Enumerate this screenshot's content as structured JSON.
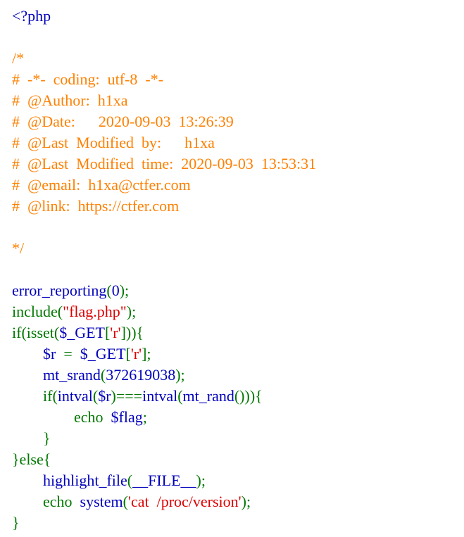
{
  "colors": {
    "html": "#0000BB",
    "comment": "#FF8000",
    "default": "#0000BB",
    "keyword": "#007700",
    "string": "#DD0000"
  },
  "source_lines": [
    [
      {
        "t": "<?php",
        "c": "html"
      }
    ],
    [],
    [
      {
        "t": "/*",
        "c": "comment"
      }
    ],
    [
      {
        "t": "#  -*-  coding:  utf-8  -*-",
        "c": "comment"
      }
    ],
    [
      {
        "t": "#  @Author:  h1xa",
        "c": "comment"
      }
    ],
    [
      {
        "t": "#  @Date:      2020-09-03  13:26:39",
        "c": "comment"
      }
    ],
    [
      {
        "t": "#  @Last  Modified  by:      h1xa",
        "c": "comment"
      }
    ],
    [
      {
        "t": "#  @Last  Modified  time:  2020-09-03  13:53:31",
        "c": "comment"
      }
    ],
    [
      {
        "t": "#  @email:  h1xa@ctfer.com",
        "c": "comment"
      }
    ],
    [
      {
        "t": "#  @link:  https://ctfer.com",
        "c": "comment"
      }
    ],
    [],
    [
      {
        "t": "*/",
        "c": "comment"
      }
    ],
    [],
    [
      {
        "t": "error_reporting",
        "c": "default"
      },
      {
        "t": "(",
        "c": "keyword"
      },
      {
        "t": "0",
        "c": "default"
      },
      {
        "t": ");",
        "c": "keyword"
      }
    ],
    [
      {
        "t": "include(",
        "c": "keyword"
      },
      {
        "t": "\"flag.php\"",
        "c": "string"
      },
      {
        "t": ");",
        "c": "keyword"
      }
    ],
    [
      {
        "t": "if(isset(",
        "c": "keyword"
      },
      {
        "t": "$_GET",
        "c": "default"
      },
      {
        "t": "[",
        "c": "keyword"
      },
      {
        "t": "'r'",
        "c": "string"
      },
      {
        "t": "])){",
        "c": "keyword"
      }
    ],
    [
      {
        "t": "        ",
        "c": "default"
      },
      {
        "t": "$r",
        "c": "default"
      },
      {
        "t": "  =  ",
        "c": "keyword"
      },
      {
        "t": "$_GET",
        "c": "default"
      },
      {
        "t": "[",
        "c": "keyword"
      },
      {
        "t": "'r'",
        "c": "string"
      },
      {
        "t": "];",
        "c": "keyword"
      }
    ],
    [
      {
        "t": "        ",
        "c": "default"
      },
      {
        "t": "mt_srand",
        "c": "default"
      },
      {
        "t": "(",
        "c": "keyword"
      },
      {
        "t": "372619038",
        "c": "default"
      },
      {
        "t": ");",
        "c": "keyword"
      }
    ],
    [
      {
        "t": "        ",
        "c": "default"
      },
      {
        "t": "if(",
        "c": "keyword"
      },
      {
        "t": "intval",
        "c": "default"
      },
      {
        "t": "(",
        "c": "keyword"
      },
      {
        "t": "$r",
        "c": "default"
      },
      {
        "t": ")===",
        "c": "keyword"
      },
      {
        "t": "intval",
        "c": "default"
      },
      {
        "t": "(",
        "c": "keyword"
      },
      {
        "t": "mt_rand",
        "c": "default"
      },
      {
        "t": "())){",
        "c": "keyword"
      }
    ],
    [
      {
        "t": "                ",
        "c": "default"
      },
      {
        "t": "echo  ",
        "c": "keyword"
      },
      {
        "t": "$flag",
        "c": "default"
      },
      {
        "t": ";",
        "c": "keyword"
      }
    ],
    [
      {
        "t": "        ",
        "c": "default"
      },
      {
        "t": "}",
        "c": "keyword"
      }
    ],
    [
      {
        "t": "}else{",
        "c": "keyword"
      }
    ],
    [
      {
        "t": "        ",
        "c": "default"
      },
      {
        "t": "highlight_file",
        "c": "default"
      },
      {
        "t": "(",
        "c": "keyword"
      },
      {
        "t": "__FILE__",
        "c": "default"
      },
      {
        "t": ");",
        "c": "keyword"
      }
    ],
    [
      {
        "t": "        ",
        "c": "default"
      },
      {
        "t": "echo  ",
        "c": "keyword"
      },
      {
        "t": "system",
        "c": "default"
      },
      {
        "t": "(",
        "c": "keyword"
      },
      {
        "t": "'cat  /proc/version'",
        "c": "string"
      },
      {
        "t": ");",
        "c": "keyword"
      }
    ],
    [
      {
        "t": "}",
        "c": "keyword"
      }
    ]
  ]
}
